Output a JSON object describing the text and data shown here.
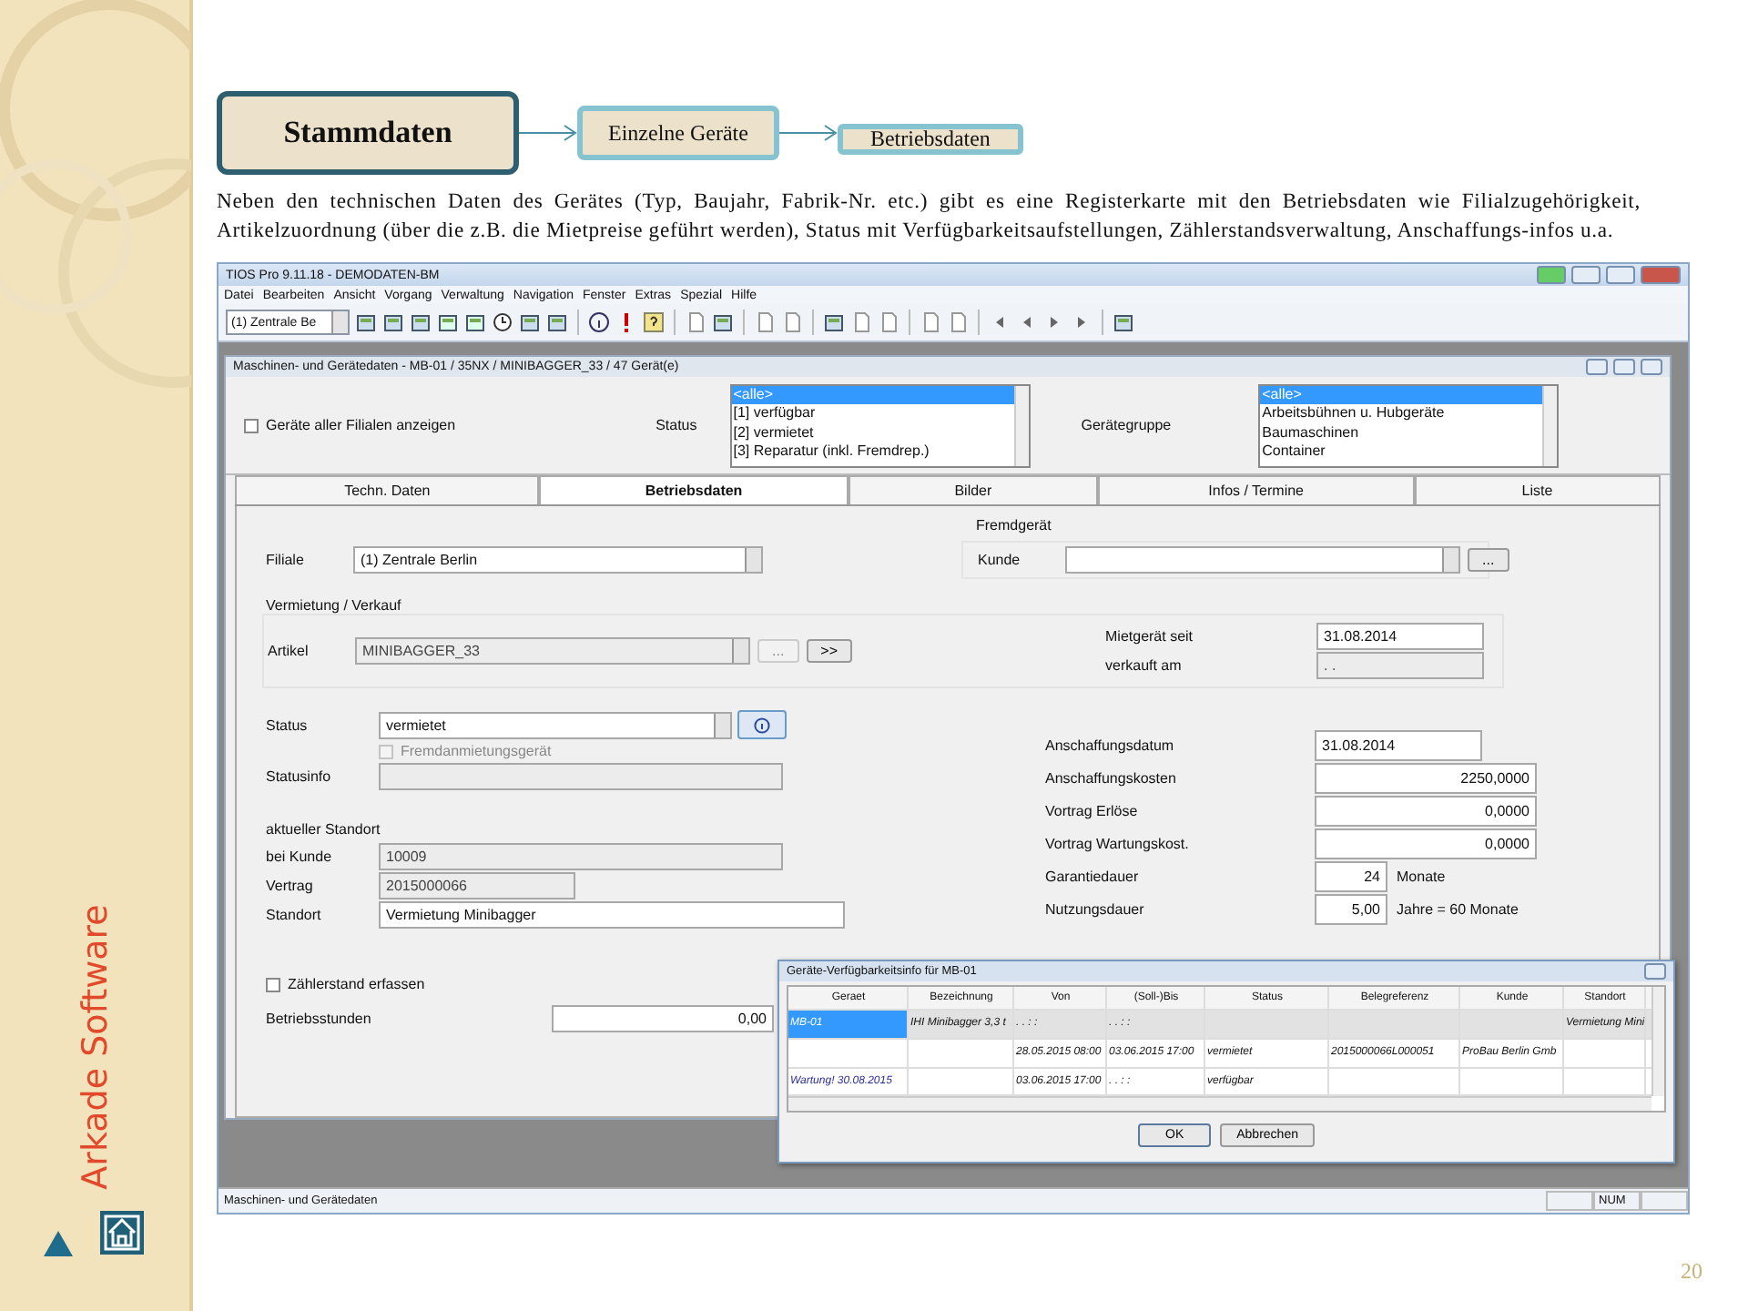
{
  "slide": {
    "steps": [
      {
        "label": "Stammdaten"
      },
      {
        "label": "Einzelne Geräte"
      },
      {
        "label": "Betriebsdaten"
      }
    ],
    "text": "Neben den technischen Daten des Gerätes (Typ, Baujahr, Fabrik-Nr. etc.) gibt es eine Registerkarte mit den Betriebsdaten wie Filialzugehörigkeit, Artikelzuordnung (über die z.B. die Mietpreise geführt werden), Status mit Verfügbarkeitsaufstellungen, Zählerstandsverwaltung, Anschaffungs-infos u.a.",
    "brand": "Arkade Software",
    "page": "20"
  },
  "window": {
    "title": "TIOS Pro 9.11.18 - DEMODATEN-BM"
  },
  "menu": [
    "Datei",
    "Bearbeiten",
    "Ansicht",
    "Vorgang",
    "Verwaltung",
    "Navigation",
    "Fenster",
    "Extras",
    "Spezial",
    "Hilfe"
  ],
  "toolbar": {
    "branch": "(1) Zentrale Be"
  },
  "child": {
    "title": "Maschinen- und Gerätedaten - MB-01 / 35NX / MINIBAGGER_33 / 47 Gerät(e)",
    "show_all": {
      "label": "Geräte aller Filialen anzeigen",
      "checked": false
    },
    "status_list": {
      "label": "Status",
      "items": [
        {
          "text": "<alle>",
          "selected": true
        },
        {
          "text": "[1] verfügbar",
          "selected": false
        },
        {
          "text": "[2] vermietet",
          "selected": false
        },
        {
          "text": "[3] Reparatur (inkl. Fremdrep.)",
          "selected": false
        }
      ]
    },
    "group_list": {
      "label": "Gerätegruppe",
      "items": [
        {
          "text": "<alle>",
          "selected": true
        },
        {
          "text": "Arbeitsbühnen u. Hubgeräte",
          "selected": false
        },
        {
          "text": "Baumaschinen",
          "selected": false
        },
        {
          "text": "Container",
          "selected": false
        }
      ]
    },
    "tabs": [
      {
        "label": "Techn. Daten",
        "selected": false
      },
      {
        "label": "Betriebsdaten",
        "selected": true
      },
      {
        "label": "Bilder",
        "selected": false
      },
      {
        "label": "Infos / Termine",
        "selected": false
      },
      {
        "label": "Liste",
        "selected": false
      }
    ],
    "form": {
      "branch": {
        "label": "Filiale",
        "value": "(1) Zentrale Berlin"
      },
      "external": {
        "title": "Fremdgerät",
        "label": "Kunde",
        "button": "..."
      },
      "rental": {
        "title": "Vermietung / Verkauf",
        "label": "Artikel",
        "value": "MINIBAGGER_33",
        "browse": "...",
        "go": ">>",
        "since_label": "Mietgerät seit",
        "since": "31.08.2014",
        "sold_label": "verkauft am",
        "sold": ". ."
      },
      "status": {
        "label": "Status",
        "value": "vermietet"
      },
      "external_rental": {
        "label": "Fremdanmietungsgerät",
        "checked": false,
        "disabled": true
      },
      "status_info": {
        "label": "Statusinfo"
      },
      "location": {
        "title": "aktueller Standort",
        "rows": [
          {
            "label": "bei Kunde",
            "value": "10009",
            "editable": false
          },
          {
            "label": "Vertrag",
            "value": "2015000066",
            "editable": false
          },
          {
            "label": "Standort",
            "value": "Vermietung Minibagger",
            "editable": true
          }
        ]
      },
      "counter": {
        "label": "Zählerstand erfassen",
        "checked": false
      },
      "hours": {
        "label": "Betriebsstunden",
        "value": "0,00"
      },
      "purchase": [
        {
          "label": "Anschaffungsdatum",
          "value": "31.08.2014",
          "kind": "date"
        },
        {
          "label": "Anschaffungskosten",
          "value": "2250,0000",
          "kind": "number"
        },
        {
          "label": "Vortrag Erlöse",
          "value": "0,0000",
          "kind": "number"
        },
        {
          "label": "Vortrag Wartungskost.",
          "value": "0,0000",
          "kind": "number"
        },
        {
          "label": "Garantiedauer",
          "value": "24",
          "unit": "Monate",
          "kind": "short"
        },
        {
          "label": "Nutzungsdauer",
          "value": "5,00",
          "unit": "Jahre = 60 Monate",
          "kind": "short"
        }
      ]
    }
  },
  "dialog": {
    "title": "Geräte-Verfügbarkeitsinfo für MB-01",
    "columns": [
      "Geraet",
      "Bezeichnung",
      "Von",
      "(Soll-)Bis",
      "Status",
      "Belegreferenz",
      "Kunde",
      "Standort"
    ],
    "rows": [
      {
        "kind": "device",
        "selected": true,
        "cells": [
          "MB-01",
          "IHI Minibagger 3,3 t",
          ". .   : :",
          ". .   : :",
          "",
          "",
          "",
          "Vermietung Mini"
        ]
      },
      {
        "kind": "booking",
        "selected": false,
        "cells": [
          "",
          "",
          "28.05.2015 08:00",
          "03.06.2015 17:00",
          "vermietet",
          "2015000066L000051",
          "ProBau Berlin Gmb",
          ""
        ]
      },
      {
        "kind": "maintenance",
        "selected": false,
        "cells": [
          "Wartung! 30.08.2015",
          "",
          "03.06.2015 17:00",
          ". .   : :",
          "verfügbar",
          "",
          "",
          ""
        ]
      }
    ],
    "buttons": [
      "OK",
      "Abbrechen"
    ]
  },
  "status_bar": {
    "text": "Maschinen- und Gerätedaten",
    "indicator": "NUM"
  }
}
